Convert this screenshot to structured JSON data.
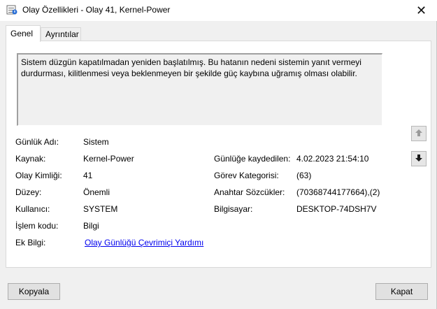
{
  "window": {
    "title": "Olay Özellikleri - Olay 41, Kernel-Power",
    "close_glyph": "✕"
  },
  "tabs": [
    {
      "label": "Genel",
      "active": true
    },
    {
      "label": "Ayrıntılar",
      "active": false
    }
  ],
  "description": "Sistem düzgün kapatılmadan yeniden başlatılmış. Bu hatanın nedeni sistemin yanıt vermeyi durdurması, kilitlenmesi veya beklenmeyen bir şekilde güç kaybına uğramış olması olabilir.",
  "fields_left": {
    "log_name_label": "Günlük Adı:",
    "log_name": "Sistem",
    "source_label": "Kaynak:",
    "source": "Kernel-Power",
    "event_id_label": "Olay Kimliği:",
    "event_id": "41",
    "level_label": "Düzey:",
    "level": "Önemli",
    "user_label": "Kullanıcı:",
    "user": "SYSTEM",
    "opcode_label": "İşlem kodu:",
    "opcode": "Bilgi",
    "more_info_label": "Ek Bilgi:",
    "more_info_link": "Olay Günlüğü Çevrimiçi Yardımı"
  },
  "fields_right": {
    "logged_label": "Günlüğe kaydedilen:",
    "logged": "4.02.2023 21:54:10",
    "task_category_label": "Görev Kategorisi:",
    "task_category": "(63)",
    "keywords_label": "Anahtar Sözcükler:",
    "keywords": "(70368744177664),(2)",
    "computer_label": "Bilgisayar:",
    "computer": "DESKTOP-74DSH7V"
  },
  "buttons": {
    "copy": "Kopyala",
    "close": "Kapat"
  },
  "icons": {
    "app": "event-viewer-icon",
    "prev": "arrow-up-icon",
    "next": "arrow-down-icon"
  }
}
